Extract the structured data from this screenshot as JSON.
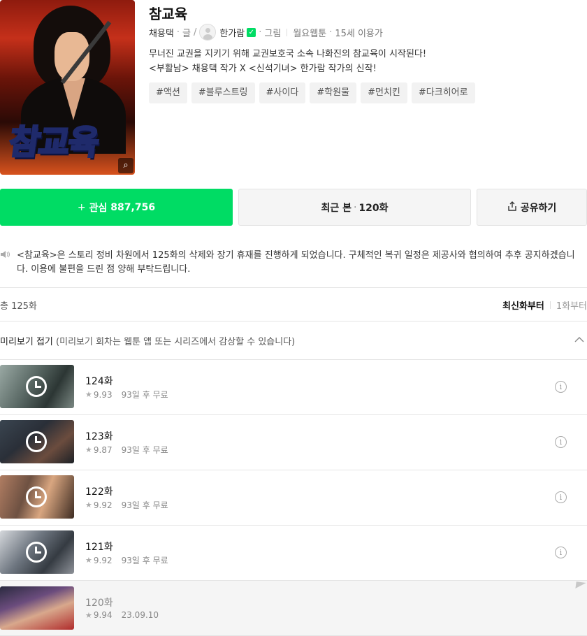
{
  "webtoon": {
    "title": "참교육",
    "cover_logo": "참교육",
    "writer": "채용택",
    "writer_role": "글",
    "artist": "한가람",
    "artist_role": "그림",
    "schedule": "월요웹툰",
    "age": "15세 이용가",
    "desc_line1": "무너진 교권을 지키기 위해 교권보호국 소속 나화진의 참교육이 시작된다!",
    "desc_line2": "<부활남> 채용택 작가 X <신석기녀> 한가람 작가의 신작!",
    "tags": [
      "#액션",
      "#블루스트링",
      "#사이다",
      "#학원물",
      "#먼치킨",
      "#다크히어로"
    ]
  },
  "actions": {
    "favorite_label": "관심",
    "favorite_count": "887,756",
    "recent_label": "최근 본",
    "recent_episode": "120화",
    "share_label": "공유하기"
  },
  "notice": "<참교육>은 스토리 정비 차원에서 125화의 삭제와 장기 휴재를 진행하게 되었습니다. 구체적인 복귀 일정은 제공사와 협의하여 추후 공지하겠습니다. 이용에 불편을 드린 점 양해 부탁드립니다.",
  "list": {
    "total": "총 125화",
    "sort_latest": "최신화부터",
    "sort_first": "1화부터",
    "preview_strong": "미리보기 접기",
    "preview_note": "(미리보기 회차는 웹툰 앱 또는 시리즈에서 감상할 수 있습니다)"
  },
  "episodes": [
    {
      "title": "124화",
      "rating": "9.93",
      "info": "93일 후 무료"
    },
    {
      "title": "123화",
      "rating": "9.87",
      "info": "93일 후 무료"
    },
    {
      "title": "122화",
      "rating": "9.92",
      "info": "93일 후 무료"
    },
    {
      "title": "121화",
      "rating": "9.92",
      "info": "93일 후 무료"
    },
    {
      "title": "120화",
      "rating": "9.94",
      "info": "23.09.10"
    }
  ],
  "colors": {
    "accent": "#00dc64",
    "read_row": "#f5f5f5"
  },
  "icons": {
    "favorite": "plus-icon",
    "share": "share-icon",
    "notice": "speaker-icon",
    "preview_toggle": "chevron-up-icon",
    "locked": "clock-icon",
    "info": "info-icon"
  }
}
